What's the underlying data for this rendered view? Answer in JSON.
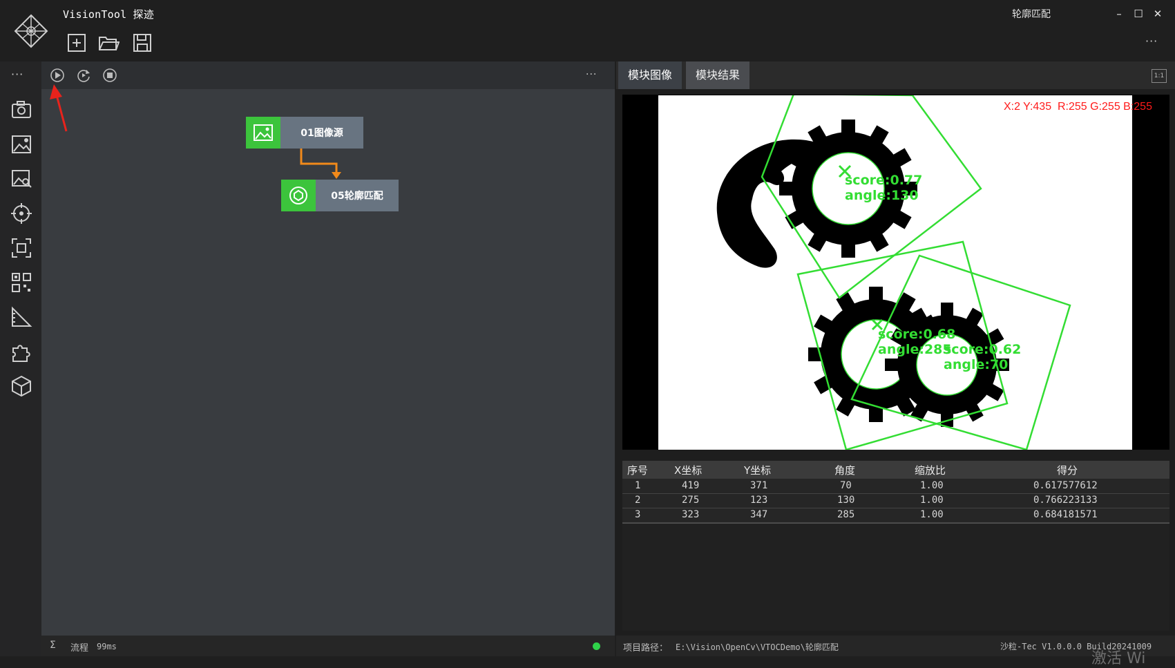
{
  "app": {
    "title": "VisionTool 探迹"
  },
  "toolbar": {
    "new_icon": "new-file-icon",
    "open_icon": "open-folder-icon",
    "save_icon": "save-icon",
    "more": "···"
  },
  "window": {
    "module_name": "轮廓匹配",
    "minimize": "–",
    "maximize": "☐",
    "close": "✕"
  },
  "sidebar": {
    "more": "···",
    "items": [
      "camera-icon",
      "image-settings-icon",
      "image-search-icon",
      "crosshair-icon",
      "focus-frame-icon",
      "qr-code-icon",
      "measure-ruler-icon",
      "plugin-puzzle-icon",
      "cube-icon"
    ]
  },
  "flow": {
    "controls": [
      "run-once-icon",
      "run-loop-icon",
      "stop-icon"
    ],
    "more": "···",
    "nodes": [
      {
        "label": "01图像源",
        "icon": "image-icon"
      },
      {
        "label": "05轮廓匹配",
        "icon": "shape-match-icon"
      }
    ],
    "status": {
      "sigma": "Σ",
      "label": "流程",
      "time": "99ms"
    }
  },
  "colors": {
    "accent_green": "#3cc43c",
    "node_label_bg": "#687481",
    "connector": "#f28a1a",
    "match_green": "#33dd33",
    "pixel_text": "#ff1a1a",
    "status_ok": "#2fd24a"
  },
  "tabs": [
    {
      "label": "模块图像",
      "active": true
    },
    {
      "label": "模块结果",
      "active": false
    }
  ],
  "image": {
    "ratio_label": "1:1",
    "pixel_info": "X:2 Y:435  R:255 G:255 B:255",
    "annotations": [
      {
        "score": "score:0.77",
        "angle": "angle:130"
      },
      {
        "score": "score:0.68",
        "angle": "angle:285"
      },
      {
        "score": "score:0.62",
        "angle": "angle:70"
      }
    ]
  },
  "results": {
    "headers": [
      "序号",
      "X坐标",
      "Y坐标",
      "角度",
      "缩放比",
      "得分"
    ],
    "rows": [
      [
        "1",
        "419",
        "371",
        "70",
        "1.00",
        "0.617577612"
      ],
      [
        "2",
        "275",
        "123",
        "130",
        "1.00",
        "0.766223133"
      ],
      [
        "3",
        "323",
        "347",
        "285",
        "1.00",
        "0.684181571"
      ]
    ]
  },
  "footer": {
    "path_label": "项目路径：",
    "path_value": "E:\\Vision\\OpenCv\\VTOCDemo\\轮廓匹配",
    "build": "沙粒-Tec V1.0.0.0 Build20241009",
    "watermark": "激活 Wi"
  }
}
